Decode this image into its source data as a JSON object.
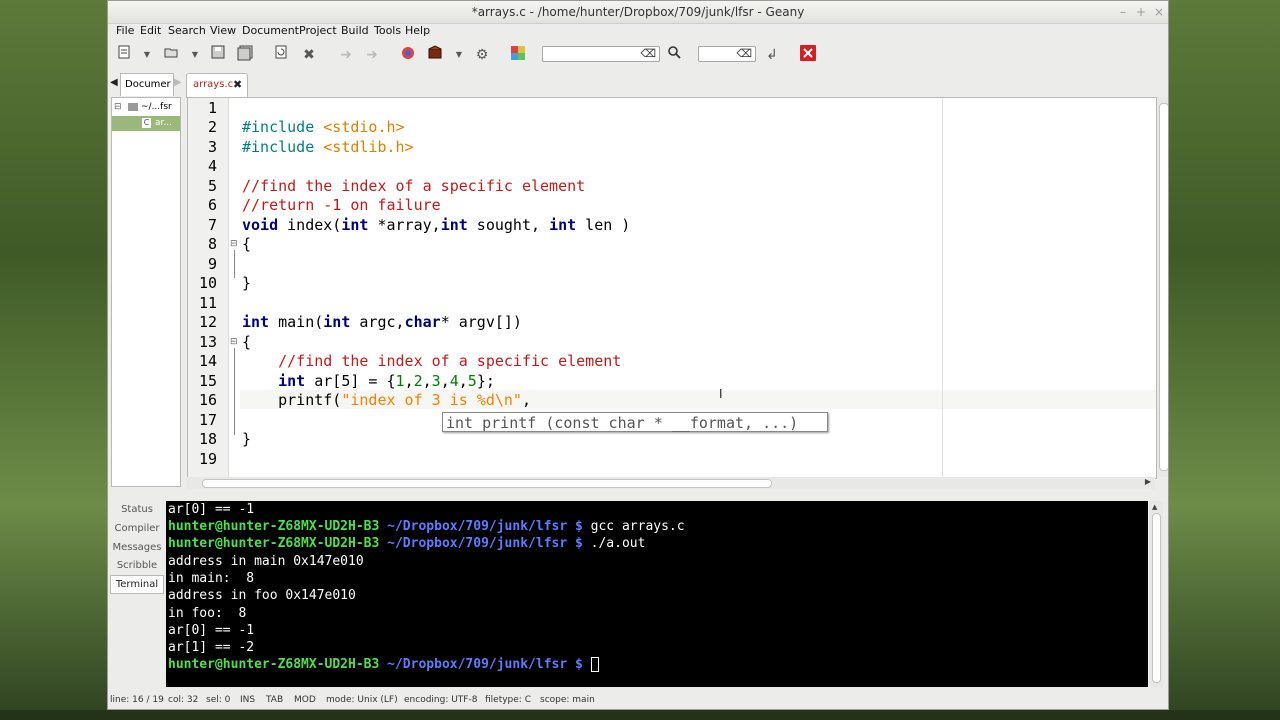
{
  "window": {
    "title": "*arrays.c - /home/hunter/Dropbox/709/junk/lfsr - Geany"
  },
  "menu": [
    "File",
    "Edit",
    "Search",
    "View",
    "Document",
    "Project",
    "Build",
    "Tools",
    "Help"
  ],
  "sidebar": {
    "tab_label": "Documer",
    "tree": {
      "folder_label": "~/...fsr",
      "file_label": "ar..."
    }
  },
  "editor": {
    "tab_label": "arrays.c",
    "lines": [
      {
        "n": "1"
      },
      {
        "n": "2"
      },
      {
        "n": "3"
      },
      {
        "n": "4"
      },
      {
        "n": "5"
      },
      {
        "n": "6"
      },
      {
        "n": "7"
      },
      {
        "n": "8"
      },
      {
        "n": "9"
      },
      {
        "n": "10"
      },
      {
        "n": "11"
      },
      {
        "n": "12"
      },
      {
        "n": "13"
      },
      {
        "n": "14"
      },
      {
        "n": "15"
      },
      {
        "n": "16"
      },
      {
        "n": "17"
      },
      {
        "n": "18"
      },
      {
        "n": "19"
      }
    ],
    "code": {
      "l2a": "#include ",
      "l2b": "<stdio.h>",
      "l3a": "#include ",
      "l3b": "<stdlib.h>",
      "l5": "//find the index of a specific element",
      "l6": "//return -1 on failure",
      "l7a": "void",
      "l7b": " index(",
      "l7c": "int",
      "l7d": " *array,",
      "l7e": "int",
      "l7f": " sought, ",
      "l7g": "int",
      "l7h": " len )",
      "l8": "{",
      "l10": "}",
      "l12a": "int",
      "l12b": " main(",
      "l12c": "int",
      "l12d": " argc,",
      "l12e": "char",
      "l12f": "* argv[])",
      "l13": "{",
      "l14": "    //find the index of a specific element",
      "l15a": "    ",
      "l15b": "int",
      "l15c": " ar[5] = {",
      "l15d": "1",
      "l15e": ",",
      "l15f": "2",
      "l15g": ",",
      "l15h": "3",
      "l15i": ",",
      "l15j": "4",
      "l15k": ",",
      "l15l": "5",
      "l15m": "};",
      "l16a": "    printf(",
      "l16b": "\"index of 3 is %d\\n\"",
      "l16c": ",",
      "l18": "}"
    },
    "calltip": "int printf (const char * __format, ...)"
  },
  "panel_tabs": [
    "Status",
    "Compiler",
    "Messages",
    "Scribble",
    "Terminal"
  ],
  "terminal": {
    "lines": [
      {
        "text": "ar[0] == -1"
      },
      {
        "user": "hunter@hunter-Z68MX-UD2H-B3",
        "path": " ~/Dropbox/709/junk/lfsr $",
        "cmd": " gcc arrays.c"
      },
      {
        "user": "hunter@hunter-Z68MX-UD2H-B3",
        "path": " ~/Dropbox/709/junk/lfsr $",
        "cmd": " ./a.out"
      },
      {
        "text": "address in main 0x147e010"
      },
      {
        "text": "in main:  8"
      },
      {
        "text": "address in foo 0x147e010"
      },
      {
        "text": "in foo:  8"
      },
      {
        "text": "ar[0] == -1"
      },
      {
        "text": "ar[1] == -2"
      },
      {
        "user": "hunter@hunter-Z68MX-UD2H-B3",
        "path": " ~/Dropbox/709/junk/lfsr $",
        "cmd": " "
      }
    ]
  },
  "statusbar": {
    "line": "line: 16 / 19",
    "col": "col: 32",
    "sel": "sel: 0",
    "ins": "INS",
    "tab": "TAB",
    "mod": "MOD",
    "mode": "mode: Unix (LF)",
    "encoding": "encoding: UTF-8",
    "filetype": "filetype: C",
    "scope": "scope: main"
  },
  "colors": {
    "keyword": "#00007f",
    "comment": "#c81818",
    "string": "#ff7f00",
    "number": "#007f00",
    "include": "#e08000",
    "prompt_user": "#4ce04c",
    "prompt_path": "#5c7cff"
  },
  "icons": [
    "new-file-icon",
    "open-file-icon",
    "save-icon",
    "save-all-icon",
    "revert-icon",
    "close-icon",
    "back-icon",
    "forward-icon",
    "compile-icon",
    "build-icon",
    "run-icon",
    "preferences-icon",
    "color-chooser-icon",
    "search-icon",
    "jump-to-line-icon",
    "quit-icon"
  ]
}
